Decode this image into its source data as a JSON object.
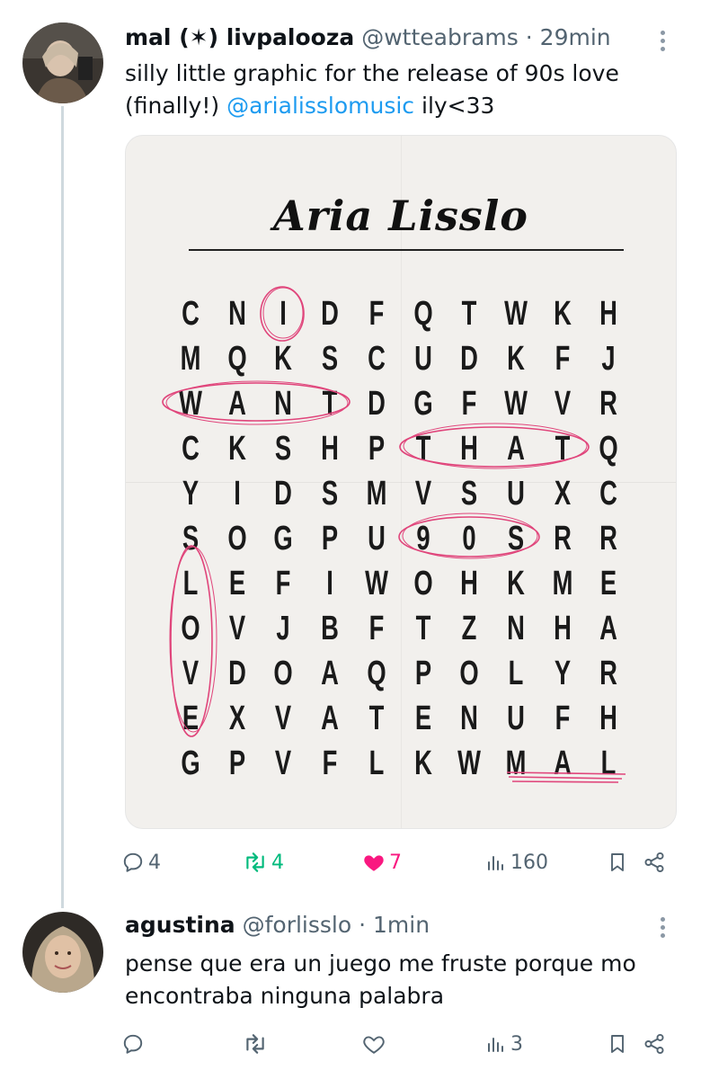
{
  "tweet": {
    "name": "mal (✶) livpalooza",
    "handle": "@wtteabrams",
    "dot": "·",
    "time": "29min",
    "text_line1": "silly little graphic for the release of 90s love",
    "text_line2_prefix": "(finally!) ",
    "mention": "@arialisslomusic",
    "text_line2_suffix": " ily<33",
    "media": {
      "title": "Aria Lisslo",
      "grid": [
        [
          "C",
          "N",
          "I",
          "D",
          "F",
          "Q",
          "T",
          "W",
          "K",
          "H"
        ],
        [
          "M",
          "Q",
          "K",
          "S",
          "C",
          "U",
          "D",
          "K",
          "F",
          "J"
        ],
        [
          "W",
          "A",
          "N",
          "T",
          "D",
          "G",
          "F",
          "W",
          "V",
          "R"
        ],
        [
          "C",
          "K",
          "S",
          "H",
          "P",
          "T",
          "H",
          "A",
          "T",
          "Q"
        ],
        [
          "Y",
          "I",
          "D",
          "S",
          "M",
          "V",
          "S",
          "U",
          "X",
          "C"
        ],
        [
          "S",
          "O",
          "G",
          "P",
          "U",
          "9",
          "0",
          "S",
          "R",
          "R"
        ],
        [
          "L",
          "E",
          "F",
          "I",
          "W",
          "O",
          "H",
          "K",
          "M",
          "E"
        ],
        [
          "O",
          "V",
          "J",
          "B",
          "F",
          "T",
          "Z",
          "N",
          "H",
          "A"
        ],
        [
          "V",
          "D",
          "O",
          "A",
          "Q",
          "P",
          "O",
          "L",
          "Y",
          "R"
        ],
        [
          "E",
          "X",
          "V",
          "A",
          "T",
          "E",
          "N",
          "U",
          "F",
          "H"
        ],
        [
          "G",
          "P",
          "V",
          "F",
          "L",
          "K",
          "W",
          "M",
          "A",
          "L"
        ]
      ],
      "highlight_color": "#e0457b"
    },
    "actions": {
      "replies": "4",
      "retweets": "4",
      "likes": "7",
      "views": "160"
    }
  },
  "reply": {
    "name": "agustina",
    "handle": "@forlisslo",
    "dot": "·",
    "time": "1min",
    "text_line1": "pense que era un juego me fruste porque mo",
    "text_line2": "encontraba ninguna palabra",
    "actions": {
      "replies": "",
      "retweets": "",
      "likes": "",
      "views": "3"
    }
  },
  "colors": {
    "accent": "#1d9bf0",
    "muted": "#536471",
    "retweet_green": "#00ba7c",
    "like_pink": "#f91880"
  },
  "icons": [
    "more-icon",
    "reply-icon",
    "retweet-icon",
    "like-icon",
    "views-icon",
    "bookmark-icon",
    "share-icon"
  ]
}
